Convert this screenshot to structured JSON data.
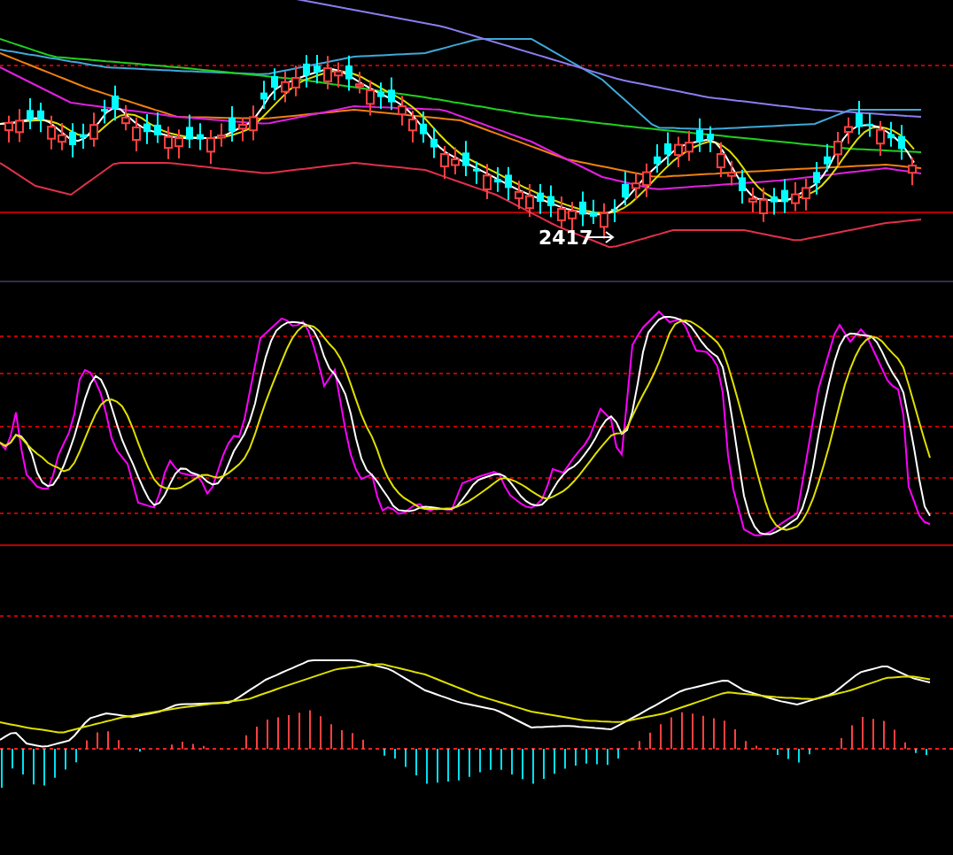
{
  "panels": [
    {
      "kind": "candles",
      "low_label": "2417"
    },
    {
      "kind": "oscillator"
    },
    {
      "kind": "macd"
    }
  ]
}
